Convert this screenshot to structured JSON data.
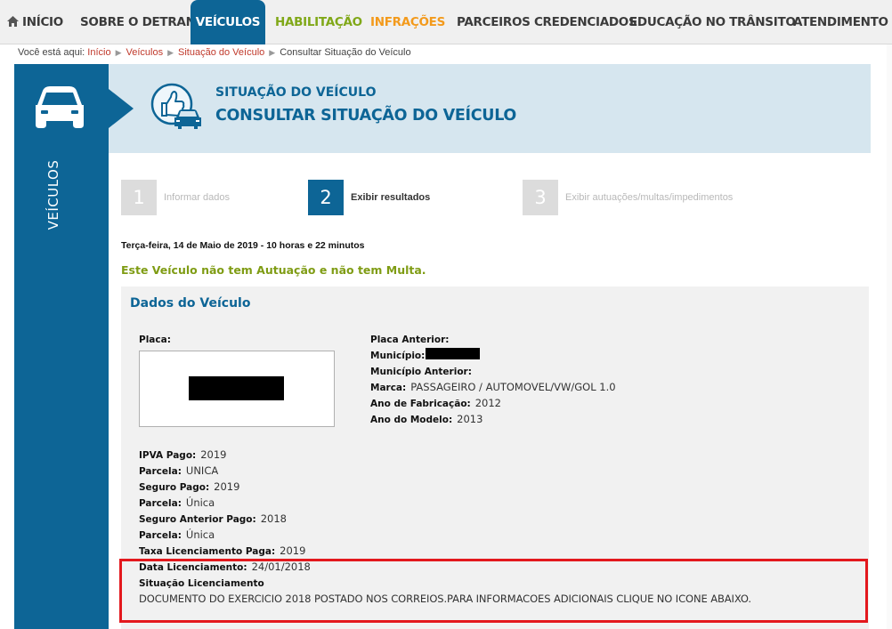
{
  "nav": {
    "items": [
      {
        "label": "INÍCIO"
      },
      {
        "label": "SOBRE O DETRAN"
      },
      {
        "label": "VEÍCULOS"
      },
      {
        "label": "HABILITAÇÃO"
      },
      {
        "label": "INFRAÇÕES"
      },
      {
        "label": "PARCEIROS CREDENCIADOS"
      },
      {
        "label": "EDUCAÇÃO NO TRÂNSITO"
      },
      {
        "label": "ATENDIMENTO"
      }
    ],
    "colors": {
      "active": "#0d6596",
      "habilitacao": "#80a818",
      "infracoes": "#f39a1c"
    }
  },
  "breadcrumb": {
    "prefix": "Você está aqui:",
    "items": [
      "Início",
      "Veículos",
      "Situação do Veículo"
    ],
    "current": "Consultar Situação do Veículo"
  },
  "sidebar": {
    "label": "VEÍCULOS",
    "icon": "car-icon"
  },
  "header": {
    "icon": "thumbs-up-car-icon",
    "subtitle": "SITUAÇÃO DO VEÍCULO",
    "title": "CONSULTAR SITUAÇÃO DO VEÍCULO"
  },
  "steps": [
    {
      "number": "1",
      "label": "Informar dados",
      "state": "inactive"
    },
    {
      "number": "2",
      "label": "Exibir resultados",
      "state": "active"
    },
    {
      "number": "3",
      "label": "Exibir autuações/multas/impedimentos",
      "state": "inactive"
    }
  ],
  "datetime": "Terça-feira, 14 de Maio de 2019 - 10 horas e 22 minutos",
  "alert": "Este Veículo não tem Autuação e não tem Multa.",
  "vehicle": {
    "section_title": "Dados do Veículo",
    "placa_label": "Placa:",
    "placa_anterior_label": "Placa Anterior:",
    "municipio_label": "Município:",
    "municipio_anterior_label": "Município Anterior:",
    "marca_label": "Marca:",
    "marca_value": "PASSAGEIRO / AUTOMOVEL/VW/GOL 1.0",
    "ano_fab_label": "Ano de Fabricação:",
    "ano_fab_value": "2012",
    "ano_modelo_label": "Ano do Modelo:",
    "ano_modelo_value": "2013"
  },
  "payments": {
    "ipva_label": "IPVA Pago:",
    "ipva_value": "2019",
    "parcela1_label": "Parcela:",
    "parcela1_value": "UNICA",
    "seguro_label": "Seguro Pago:",
    "seguro_value": "2019",
    "parcela2_label": "Parcela:",
    "parcela2_value": "Única",
    "seguro_ant_label": "Seguro Anterior Pago:",
    "seguro_ant_value": "2018",
    "parcela3_label": "Parcela:",
    "parcela3_value": "Única",
    "taxa_label": "Taxa Licenciamento Paga:",
    "taxa_value": "2019",
    "data_lic_label": "Data Licenciamento:",
    "data_lic_value": "24/01/2018",
    "situacao_label": "Situação Licenciamento",
    "situacao_value": "DOCUMENTO DO EXERCICIO 2018 POSTADO NOS CORREIOS.PARA INFORMACOES ADICIONAIS CLIQUE NO ICONE ABAIXO."
  },
  "highlight_color": "#e3181d"
}
